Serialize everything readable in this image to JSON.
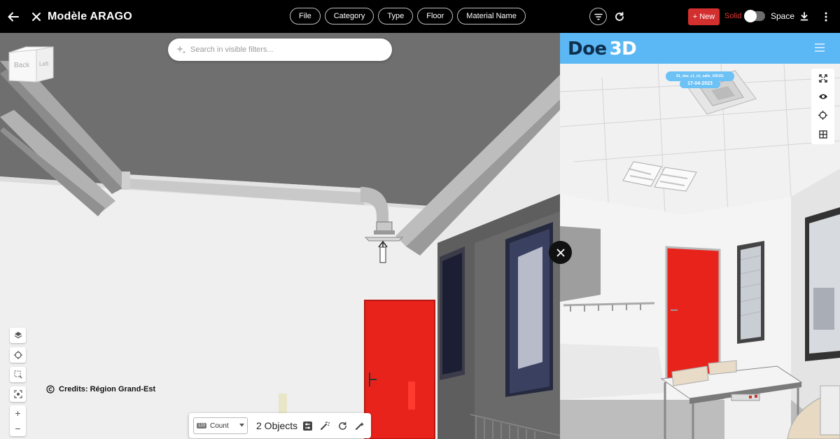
{
  "app": {
    "title": "Modèle ARAGO"
  },
  "toolbar": {
    "filters": [
      "File",
      "Category",
      "Type",
      "Floor",
      "Material Name"
    ],
    "new_label": "+ New",
    "solid_label": "Solid",
    "space_label": "Space",
    "toggle_on": false
  },
  "viewer": {
    "search_placeholder": "Search in visible filters...",
    "viewcube_faces": [
      "Back",
      "Left"
    ],
    "credits": "Credits: Région Grand-Est",
    "count_label": "Count",
    "count_badge": "123",
    "objects_label": "2 Objects"
  },
  "panorama": {
    "logo_left": "Doe",
    "logo_right": "3D",
    "scene_name": "S1_doe_c1_n1_salle_100151",
    "scene_date": "17-04-2023"
  },
  "colors": {
    "topbar": "#000000",
    "new_button": "#d32f2f",
    "solid_text": "#e53935",
    "doe_header": "#5bb8f5",
    "door": "#e8231c"
  }
}
